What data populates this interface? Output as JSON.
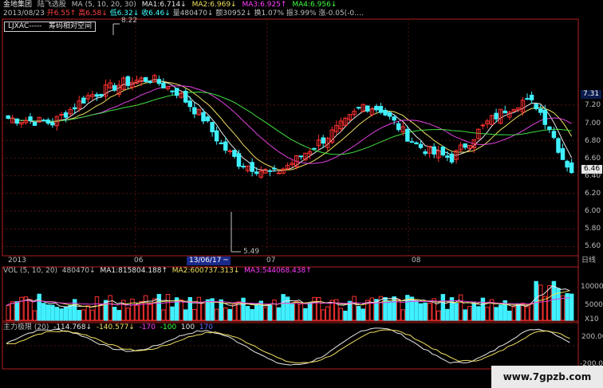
{
  "header": {
    "stock": "金地集团",
    "indicator_name": "陆飞选股",
    "ma_params": "MA (5, 10, 20, 30)",
    "ma1": "MA1:6.714↓",
    "ma2": "MA2:6.969↓",
    "ma3": "MA3:6.925↑",
    "ma4": "MA4:6.956↓",
    "date": "2013/08/23",
    "open": "开6.55↑",
    "high": "高6.58↓",
    "low": "低6.32↓",
    "close": "收6.46↓",
    "volume": "量480470↓",
    "amount": "额30952↓",
    "turnover": "换1.07%",
    "amplitude": "振3.99%",
    "change": "涨-0.05(-0.…"
  },
  "note": {
    "legend": "LJXAC-----",
    "text": "筹码相对空间"
  },
  "price_axis": {
    "labels": [
      "7.31",
      "7.20",
      "7.00",
      "6.80",
      "6.60",
      "6.46",
      "6.40",
      "6.20",
      "6.00",
      "5.80",
      "5.60"
    ],
    "highlight_top": "7.31",
    "current": "6.46",
    "high_mark": "8.22",
    "low_mark": "5.49"
  },
  "time_axis": {
    "labels": [
      "2013",
      "06",
      "13/06/17 ─",
      "07",
      "08"
    ],
    "period": "日线"
  },
  "vol_panel": {
    "title": "VOL (5, 10, 20)",
    "value": "480470↓",
    "ma1": "MA1:815804.188↑",
    "ma2": "MA2:600737.313↓",
    "ma3": "MA3:544068.438↑",
    "axis": [
      "100000",
      "50000",
      "X10"
    ]
  },
  "main_force_panel": {
    "title": "主力极限 (20)",
    "v1": "-114.768↓",
    "v2": "-140.577↓",
    "v3": "-170",
    "v4": "-100",
    "v5": "100",
    "v6": "170",
    "axis": [
      "200.00",
      "-200.00"
    ]
  },
  "watermark": "www.7gpzb.com",
  "colors": {
    "up": "#ff3030",
    "down": "#40f0ff",
    "ma1": "#e8e8e8",
    "ma2": "#f0e060",
    "ma3": "#e040e0",
    "ma4": "#40e040",
    "border": "#b02020"
  }
}
